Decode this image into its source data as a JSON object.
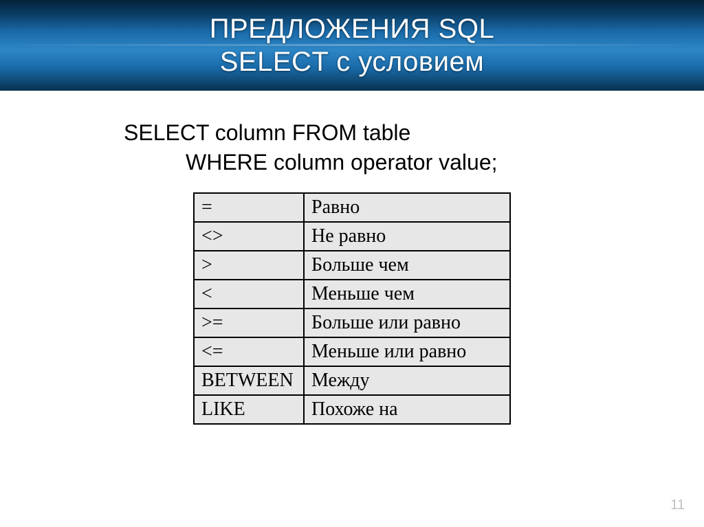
{
  "title_line1": "ПРЕДЛОЖЕНИЯ SQL",
  "title_line2": "SELECT с условием",
  "code_line1": "SELECT column FROM table",
  "code_line2": "WHERE column operator value;",
  "operators": [
    {
      "op": "=",
      "desc": "Равно"
    },
    {
      "op": "<>",
      "desc": "Не равно"
    },
    {
      "op": ">",
      "desc": "Больше чем"
    },
    {
      "op": "<",
      "desc": "Меньше чем"
    },
    {
      "op": ">=",
      "desc": "Больше или равно"
    },
    {
      "op": "<=",
      "desc": "Меньше или равно"
    },
    {
      "op": "BETWEEN",
      "desc": "Между"
    },
    {
      "op": "LIKE",
      "desc": "Похоже на"
    }
  ],
  "page_number": "11"
}
